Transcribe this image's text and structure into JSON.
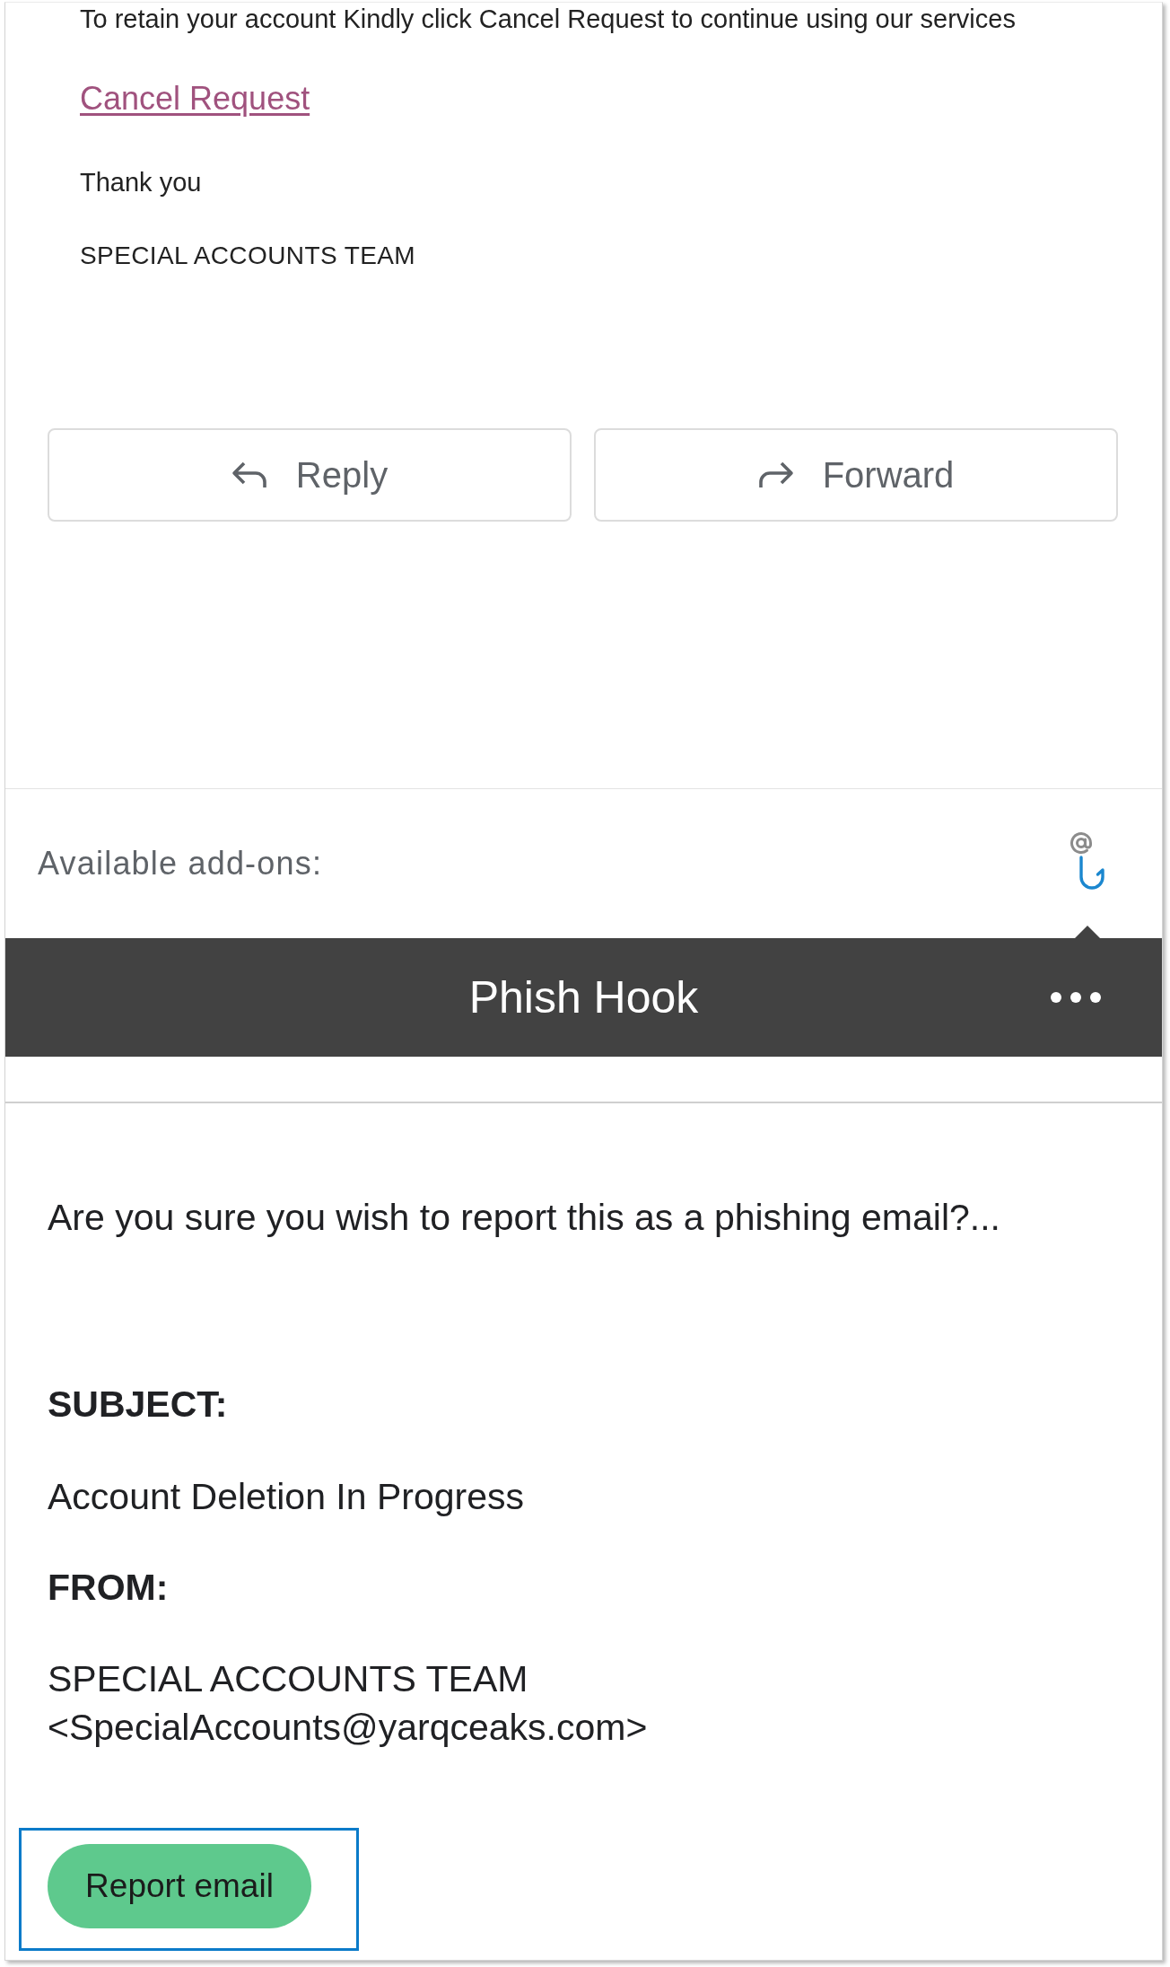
{
  "email_body": {
    "paragraph": "To retain your account Kindly click Cancel Request to continue using our services",
    "link": "Cancel Request",
    "closing": "Thank you",
    "signature": "SPECIAL ACCOUNTS TEAM"
  },
  "actions": [
    {
      "kind": "reply",
      "label": "Reply"
    },
    {
      "kind": "forward",
      "label": "Forward"
    }
  ],
  "addons": {
    "label": "Available add-ons:",
    "items": [
      {
        "kind": "hook",
        "selected": true
      }
    ]
  },
  "panel": {
    "title": "Phish Hook",
    "message": "Are you sure you wish to report this as a phishing email?...",
    "fields": [
      {
        "label": "SUBJECT:",
        "value": "Account Deletion In Progress"
      },
      {
        "label": "FROM:",
        "value": "SPECIAL ACCOUNTS TEAM <SpecialAccounts@yarqceaks.com>"
      }
    ],
    "button": {
      "label": "Report email",
      "highlighted": true
    }
  }
}
